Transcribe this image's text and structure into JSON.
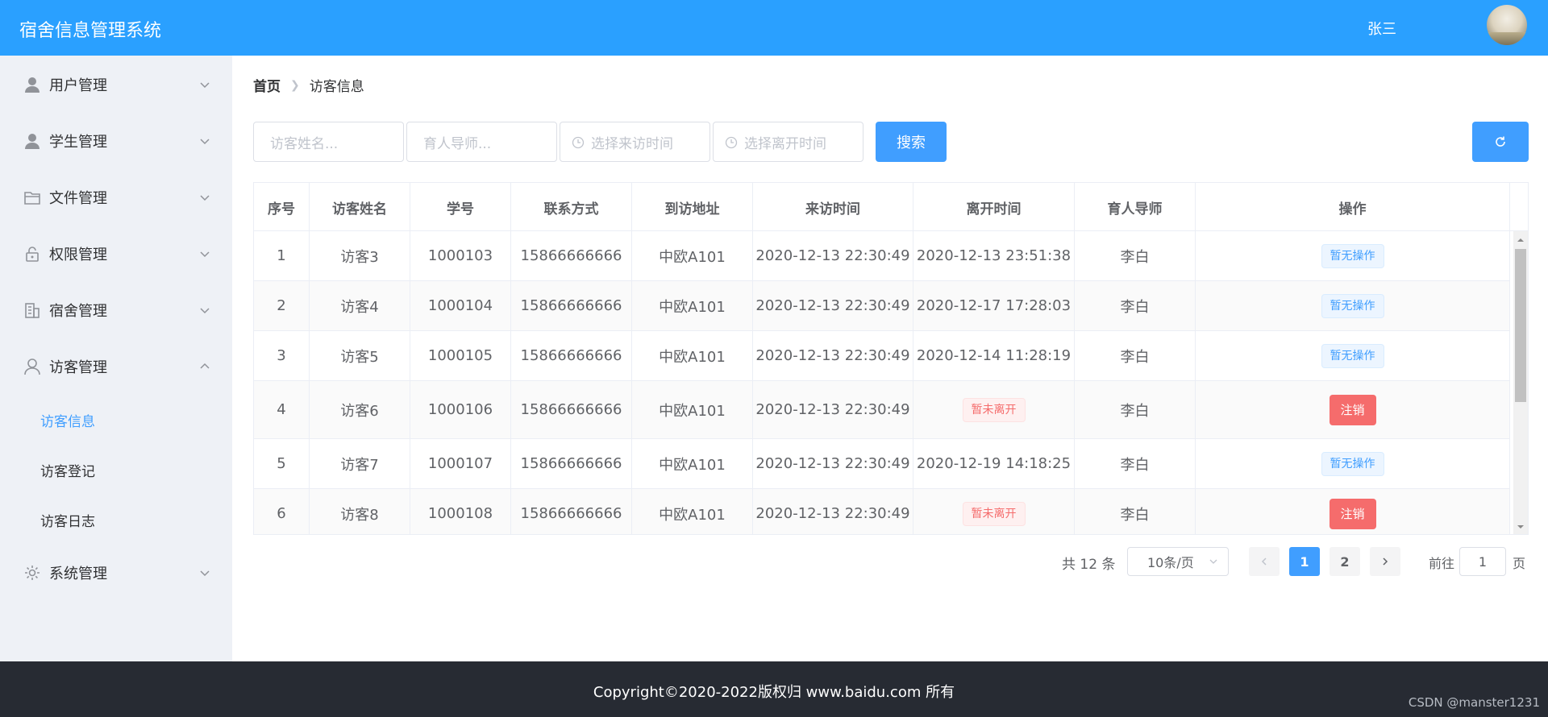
{
  "header": {
    "app_title": "宿舍信息管理系统",
    "username": "张三"
  },
  "sidebar": {
    "menus": [
      {
        "label": "用户管理",
        "icon": "user-icon",
        "expanded": false
      },
      {
        "label": "学生管理",
        "icon": "user-icon",
        "expanded": false
      },
      {
        "label": "文件管理",
        "icon": "folder-icon",
        "expanded": false
      },
      {
        "label": "权限管理",
        "icon": "lock-icon",
        "expanded": false
      },
      {
        "label": "宿舍管理",
        "icon": "building-icon",
        "expanded": false
      },
      {
        "label": "访客管理",
        "icon": "user-outline-icon",
        "expanded": true
      },
      {
        "label": "系统管理",
        "icon": "gear-icon",
        "expanded": false
      }
    ],
    "visitor_sub": [
      {
        "label": "访客信息",
        "active": true
      },
      {
        "label": "访客登记",
        "active": false
      },
      {
        "label": "访客日志",
        "active": false
      }
    ]
  },
  "breadcrumb": {
    "home": "首页",
    "current": "访客信息"
  },
  "filters": {
    "visitor_name_placeholder": "访客姓名...",
    "tutor_placeholder": "育人导师...",
    "visit_time_placeholder": "选择来访时间",
    "leave_time_placeholder": "选择离开时间",
    "search_label": "搜索"
  },
  "table": {
    "columns": [
      "序号",
      "访客姓名",
      "学号",
      "联系方式",
      "到访地址",
      "来访时间",
      "离开时间",
      "育人导师",
      "操作"
    ],
    "rows": [
      {
        "index": "1",
        "name": "访客3",
        "student_id": "1000103",
        "phone": "15866666666",
        "address": "中欧A101",
        "visit_time": "2020-12-13 22:30:49",
        "leave_time": "2020-12-13 23:51:38",
        "left": true,
        "tutor": "李白",
        "action": "暂无操作"
      },
      {
        "index": "2",
        "name": "访客4",
        "student_id": "1000104",
        "phone": "15866666666",
        "address": "中欧A101",
        "visit_time": "2020-12-13 22:30:49",
        "leave_time": "2020-12-17 17:28:03",
        "left": true,
        "tutor": "李白",
        "action": "暂无操作"
      },
      {
        "index": "3",
        "name": "访客5",
        "student_id": "1000105",
        "phone": "15866666666",
        "address": "中欧A101",
        "visit_time": "2020-12-13 22:30:49",
        "leave_time": "2020-12-14 11:28:19",
        "left": true,
        "tutor": "李白",
        "action": "暂无操作"
      },
      {
        "index": "4",
        "name": "访客6",
        "student_id": "1000106",
        "phone": "15866666666",
        "address": "中欧A101",
        "visit_time": "2020-12-13 22:30:49",
        "leave_time": "暂未离开",
        "left": false,
        "tutor": "李白",
        "action": "注销"
      },
      {
        "index": "5",
        "name": "访客7",
        "student_id": "1000107",
        "phone": "15866666666",
        "address": "中欧A101",
        "visit_time": "2020-12-13 22:30:49",
        "leave_time": "2020-12-19 14:18:25",
        "left": true,
        "tutor": "李白",
        "action": "暂无操作"
      },
      {
        "index": "6",
        "name": "访客8",
        "student_id": "1000108",
        "phone": "15866666666",
        "address": "中欧A101",
        "visit_time": "2020-12-13 22:30:49",
        "leave_time": "暂未离开",
        "left": false,
        "tutor": "李白",
        "action": "注销"
      }
    ]
  },
  "pagination": {
    "total": "共 12 条",
    "page_size": "10条/页",
    "pages": [
      "1",
      "2"
    ],
    "current_page": "1",
    "goto_label": "前往",
    "goto_value": "1",
    "page_unit": "页"
  },
  "footer": {
    "copyright": "Copyright©2020-2022版权归 www.baidu.com 所有",
    "watermark": "CSDN @manster1231"
  },
  "colors": {
    "header_bg": "#2aa0ff",
    "primary": "#409eff",
    "danger": "#f56c6c",
    "sidebar_bg": "#eef1f6",
    "footer_bg": "#272b33"
  }
}
